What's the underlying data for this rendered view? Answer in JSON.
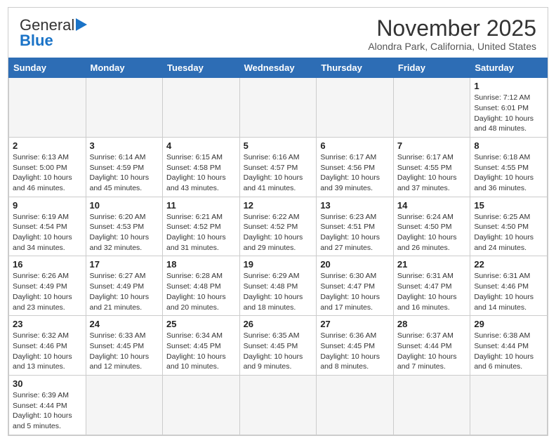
{
  "header": {
    "logo_general": "General",
    "logo_blue": "Blue",
    "month_title": "November 2025",
    "location": "Alondra Park, California, United States"
  },
  "days_of_week": [
    "Sunday",
    "Monday",
    "Tuesday",
    "Wednesday",
    "Thursday",
    "Friday",
    "Saturday"
  ],
  "weeks": [
    [
      {
        "day": null,
        "info": null
      },
      {
        "day": null,
        "info": null
      },
      {
        "day": null,
        "info": null
      },
      {
        "day": null,
        "info": null
      },
      {
        "day": null,
        "info": null
      },
      {
        "day": null,
        "info": null
      },
      {
        "day": "1",
        "info": "Sunrise: 7:12 AM\nSunset: 6:01 PM\nDaylight: 10 hours and 48 minutes."
      }
    ],
    [
      {
        "day": "2",
        "info": "Sunrise: 6:13 AM\nSunset: 5:00 PM\nDaylight: 10 hours and 46 minutes."
      },
      {
        "day": "3",
        "info": "Sunrise: 6:14 AM\nSunset: 4:59 PM\nDaylight: 10 hours and 45 minutes."
      },
      {
        "day": "4",
        "info": "Sunrise: 6:15 AM\nSunset: 4:58 PM\nDaylight: 10 hours and 43 minutes."
      },
      {
        "day": "5",
        "info": "Sunrise: 6:16 AM\nSunset: 4:57 PM\nDaylight: 10 hours and 41 minutes."
      },
      {
        "day": "6",
        "info": "Sunrise: 6:17 AM\nSunset: 4:56 PM\nDaylight: 10 hours and 39 minutes."
      },
      {
        "day": "7",
        "info": "Sunrise: 6:17 AM\nSunset: 4:55 PM\nDaylight: 10 hours and 37 minutes."
      },
      {
        "day": "8",
        "info": "Sunrise: 6:18 AM\nSunset: 4:55 PM\nDaylight: 10 hours and 36 minutes."
      }
    ],
    [
      {
        "day": "9",
        "info": "Sunrise: 6:19 AM\nSunset: 4:54 PM\nDaylight: 10 hours and 34 minutes."
      },
      {
        "day": "10",
        "info": "Sunrise: 6:20 AM\nSunset: 4:53 PM\nDaylight: 10 hours and 32 minutes."
      },
      {
        "day": "11",
        "info": "Sunrise: 6:21 AM\nSunset: 4:52 PM\nDaylight: 10 hours and 31 minutes."
      },
      {
        "day": "12",
        "info": "Sunrise: 6:22 AM\nSunset: 4:52 PM\nDaylight: 10 hours and 29 minutes."
      },
      {
        "day": "13",
        "info": "Sunrise: 6:23 AM\nSunset: 4:51 PM\nDaylight: 10 hours and 27 minutes."
      },
      {
        "day": "14",
        "info": "Sunrise: 6:24 AM\nSunset: 4:50 PM\nDaylight: 10 hours and 26 minutes."
      },
      {
        "day": "15",
        "info": "Sunrise: 6:25 AM\nSunset: 4:50 PM\nDaylight: 10 hours and 24 minutes."
      }
    ],
    [
      {
        "day": "16",
        "info": "Sunrise: 6:26 AM\nSunset: 4:49 PM\nDaylight: 10 hours and 23 minutes."
      },
      {
        "day": "17",
        "info": "Sunrise: 6:27 AM\nSunset: 4:49 PM\nDaylight: 10 hours and 21 minutes."
      },
      {
        "day": "18",
        "info": "Sunrise: 6:28 AM\nSunset: 4:48 PM\nDaylight: 10 hours and 20 minutes."
      },
      {
        "day": "19",
        "info": "Sunrise: 6:29 AM\nSunset: 4:48 PM\nDaylight: 10 hours and 18 minutes."
      },
      {
        "day": "20",
        "info": "Sunrise: 6:30 AM\nSunset: 4:47 PM\nDaylight: 10 hours and 17 minutes."
      },
      {
        "day": "21",
        "info": "Sunrise: 6:31 AM\nSunset: 4:47 PM\nDaylight: 10 hours and 16 minutes."
      },
      {
        "day": "22",
        "info": "Sunrise: 6:31 AM\nSunset: 4:46 PM\nDaylight: 10 hours and 14 minutes."
      }
    ],
    [
      {
        "day": "23",
        "info": "Sunrise: 6:32 AM\nSunset: 4:46 PM\nDaylight: 10 hours and 13 minutes."
      },
      {
        "day": "24",
        "info": "Sunrise: 6:33 AM\nSunset: 4:45 PM\nDaylight: 10 hours and 12 minutes."
      },
      {
        "day": "25",
        "info": "Sunrise: 6:34 AM\nSunset: 4:45 PM\nDaylight: 10 hours and 10 minutes."
      },
      {
        "day": "26",
        "info": "Sunrise: 6:35 AM\nSunset: 4:45 PM\nDaylight: 10 hours and 9 minutes."
      },
      {
        "day": "27",
        "info": "Sunrise: 6:36 AM\nSunset: 4:45 PM\nDaylight: 10 hours and 8 minutes."
      },
      {
        "day": "28",
        "info": "Sunrise: 6:37 AM\nSunset: 4:44 PM\nDaylight: 10 hours and 7 minutes."
      },
      {
        "day": "29",
        "info": "Sunrise: 6:38 AM\nSunset: 4:44 PM\nDaylight: 10 hours and 6 minutes."
      }
    ],
    [
      {
        "day": "30",
        "info": "Sunrise: 6:39 AM\nSunset: 4:44 PM\nDaylight: 10 hours and 5 minutes."
      },
      {
        "day": null,
        "info": null
      },
      {
        "day": null,
        "info": null
      },
      {
        "day": null,
        "info": null
      },
      {
        "day": null,
        "info": null
      },
      {
        "day": null,
        "info": null
      },
      {
        "day": null,
        "info": null
      }
    ]
  ]
}
